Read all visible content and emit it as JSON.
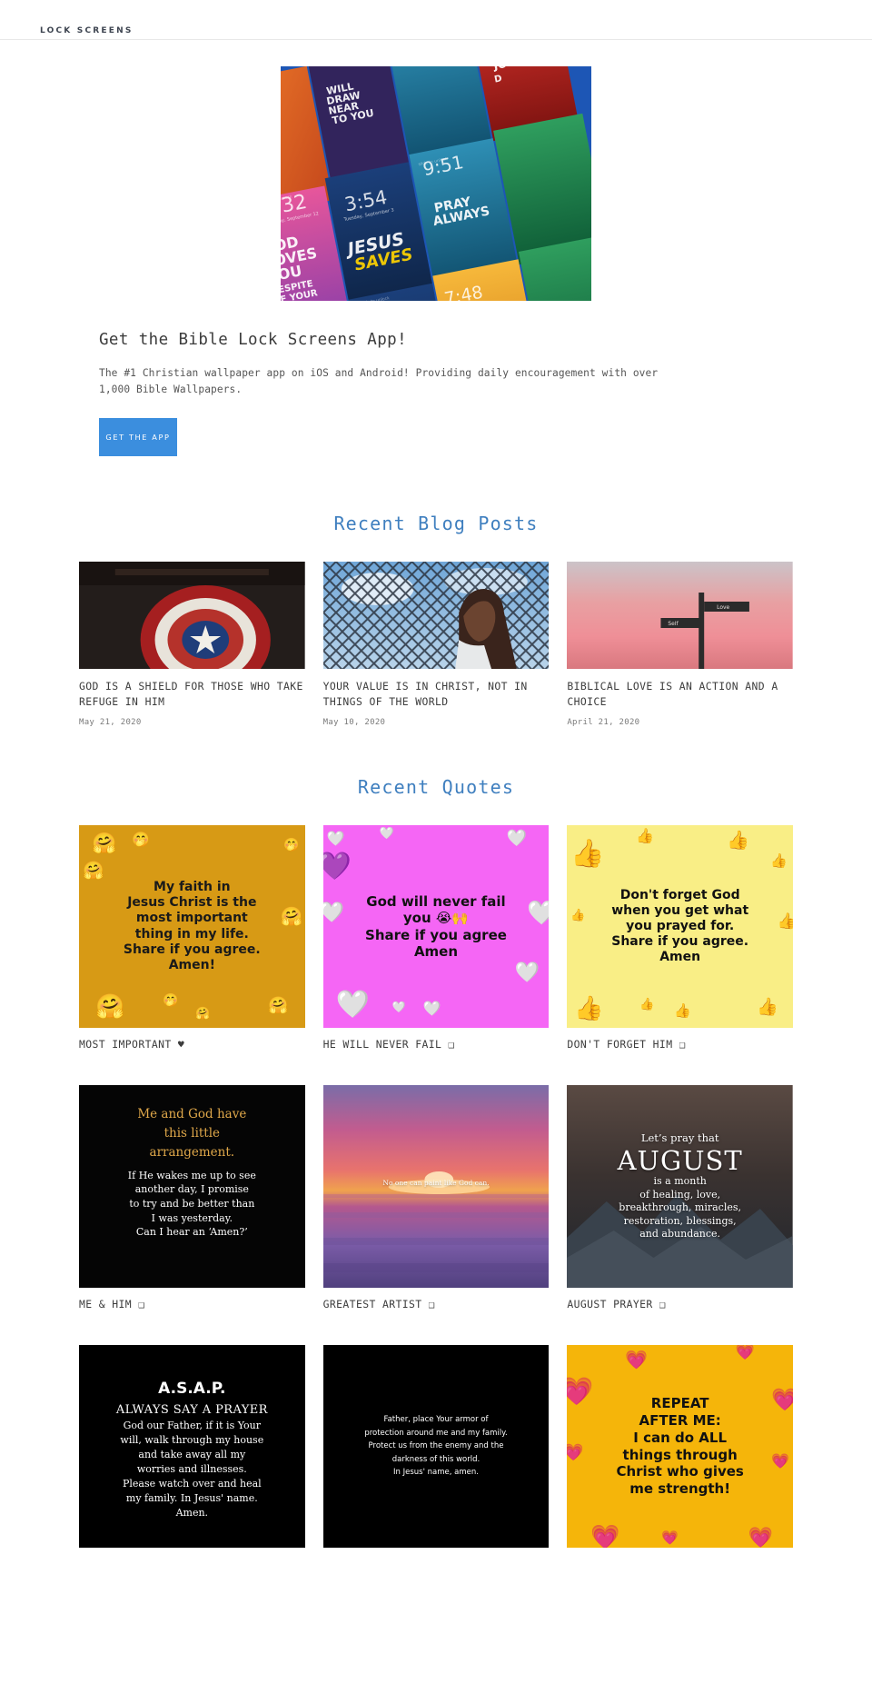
{
  "header": {
    "brand": "LOCK SCREENS"
  },
  "hero": {
    "image_alt": "bible-lock-screens-collage",
    "heading": "Get the Bible Lock Screens App!",
    "description": "The #1 Christian wallpaper app on iOS and Android! Providing daily encouragement with over 1,000 Bible Wallpapers.",
    "cta_label": "GET THE APP",
    "cta_color": "#3b8ede"
  },
  "sections": {
    "blog_title": "Recent Blog Posts",
    "quotes_title": "Recent Quotes",
    "heading_color": "#3f7fbf"
  },
  "blog_posts": [
    {
      "title": "GOD IS A SHIELD FOR THOSE WHO TAKE REFUGE IN HIM",
      "date": "May 21, 2020",
      "image_alt": "captain-america-shield"
    },
    {
      "title": "YOUR VALUE IS IN CHRIST, NOT IN THINGS OF THE WORLD",
      "date": "May 10, 2020",
      "image_alt": "woman-by-chain-link-fence"
    },
    {
      "title": "BIBLICAL LOVE IS AN ACTION AND A CHOICE",
      "date": "April 21, 2020",
      "image_alt": "signpost-at-pink-sunset"
    }
  ],
  "quotes": [
    {
      "caption": "MOST IMPORTANT ♥",
      "bg": "#d79a15",
      "text_color": "#1a1a1a",
      "lines": [
        "My faith in",
        "Jesus Christ is the",
        "most important",
        "thing in my life.",
        "Share if you agree.",
        "Amen!"
      ],
      "font_size": "14px",
      "style": "sans",
      "deco": "emoji-hugging-face"
    },
    {
      "caption": "HE WILL NEVER FAIL ❑",
      "bg": "#f566f5",
      "text_color": "#111111",
      "lines": [
        "God will never fail",
        "you 😭🙌",
        "Share if you agree",
        "Amen"
      ],
      "font_size": "15px",
      "style": "sans",
      "deco": "emoji-purple-heart"
    },
    {
      "caption": "DON'T FORGET HIM ❑",
      "bg": "#f9ee86",
      "text_color": "#111111",
      "lines": [
        "Don't forget God",
        "when you get what",
        "you prayed for.",
        "Share if you agree.",
        "Amen"
      ],
      "font_size": "14px",
      "style": "sans",
      "deco": "emoji-thumbs-up"
    },
    {
      "caption": "ME & HIM ❑",
      "bg": "#050505",
      "text_color": "#ffffff",
      "accent_color": "#e0a84a",
      "heading_lines": [
        "Me and God have",
        "this little",
        "arrangement."
      ],
      "lines": [
        "If He wakes me up to see",
        "another day, I promise",
        "to try and be better than",
        "I was yesterday.",
        "Can I hear an ‘Amen?’"
      ],
      "font_size": "11px",
      "style": "serif",
      "deco": "none"
    },
    {
      "caption": "GREATEST ARTIST ❑",
      "bg": "#b5456f",
      "text_color": "#ffffff",
      "lines": [
        "No one can paint like God can."
      ],
      "font_size": "7.5px",
      "style": "serif",
      "deco": "sunset-lake"
    },
    {
      "caption": "AUGUST PRAYER ❑",
      "bg": "#463a39",
      "text_color": "#ffffff",
      "heading_lines": [
        "Let’s pray that",
        "AUGUST"
      ],
      "lines": [
        "is a month",
        "of healing, love,",
        "breakthrough, miracles,",
        "restoration, blessings,",
        "and abundance."
      ],
      "font_size": "11px",
      "style": "serif",
      "deco": "mountain-night"
    },
    {
      "caption": "",
      "bg": "#000000",
      "text_color": "#ffffff",
      "heading_lines": [
        "A.S.A.P.",
        "ALWAYS SAY A PRAYER"
      ],
      "lines": [
        "God our Father, if it is Your",
        "will, walk through my house",
        "and take away all my",
        "worries and illnesses.",
        "Please watch over and heal",
        "my family. In Jesus' name.",
        "Amen."
      ],
      "font_size": "11px",
      "style": "serif",
      "deco": "none"
    },
    {
      "caption": "",
      "bg": "#000000",
      "text_color": "#ffffff",
      "lines": [
        "Father, place Your armor of",
        "protection around me and my family.",
        "Protect us from the enemy and the",
        "darkness of this world.",
        "In Jesus' name, amen."
      ],
      "font_size": "8.5px",
      "style": "sans",
      "deco": "none"
    },
    {
      "caption": "",
      "bg": "#f5b50a",
      "text_color": "#111111",
      "lines": [
        "REPEAT",
        "AFTER ME:",
        "I can do ALL",
        "things through",
        "Christ who gives",
        "me strength!"
      ],
      "font_size": "15px",
      "style": "sans",
      "deco": "emoji-pink-heart"
    }
  ]
}
